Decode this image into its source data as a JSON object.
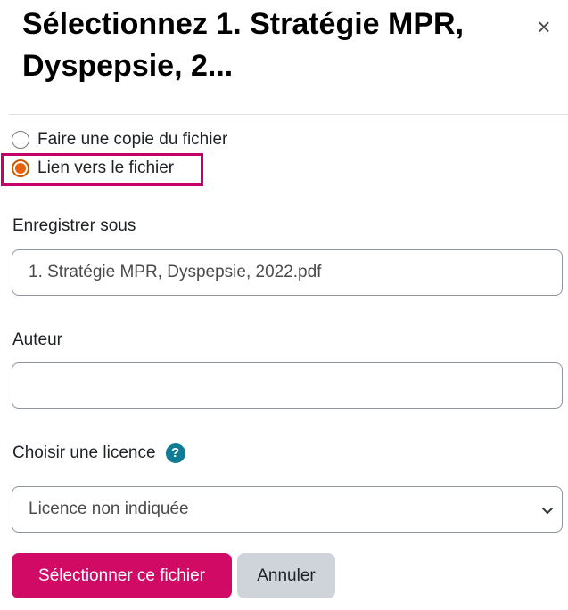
{
  "dialog": {
    "title": "Sélectionnez 1. Stratégie MPR, Dyspepsie, 2...",
    "close_icon": "close-icon",
    "close_symbol": "×"
  },
  "options": {
    "copy_label": "Faire une copie du fichier",
    "link_label": "Lien vers le fichier",
    "selected": "link"
  },
  "save_as": {
    "label": "Enregistrer sous",
    "value": "1. Stratégie MPR, Dyspepsie, 2022.pdf"
  },
  "author": {
    "label": "Auteur",
    "value": ""
  },
  "license": {
    "label": "Choisir une licence",
    "help_icon": "question-circle-icon",
    "help_symbol": "?",
    "selected": "Licence non indiquée",
    "chevron_icon": "chevron-down-icon"
  },
  "buttons": {
    "select_label": "Sélectionner ce fichier",
    "cancel_label": "Annuler"
  },
  "colors": {
    "primary": "#d10a66",
    "highlight": "#c3006b",
    "radio_checked": "#e8620c",
    "help_icon": "#0f7c93",
    "secondary_button": "#ced4da"
  }
}
